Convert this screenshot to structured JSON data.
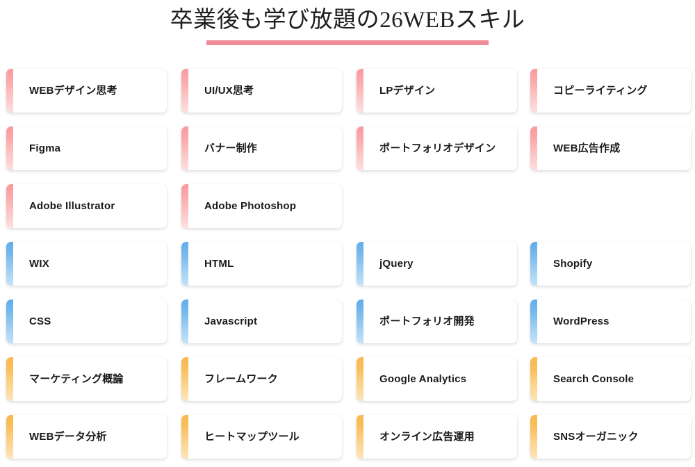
{
  "heading": {
    "title": "卒業後も学び放題の26WEBスキル",
    "rule_color": "#ef8c99"
  },
  "palette": {
    "pink_top": "#f89a9d",
    "pink_bottom": "#fde0df",
    "blue_top": "#62acea",
    "blue_bottom": "#c4e2f7",
    "orange_top": "#f8b84e",
    "orange_bottom": "#fde4b8",
    "card_background": "#ffffff",
    "text": "#1a1a1a",
    "page_background": "#ffffff"
  },
  "grid": {
    "columns": 4,
    "rows": 7,
    "total_cards": 26
  },
  "cards": [
    {
      "label": "WEBデザイン思考",
      "accent": "pink",
      "row": 1,
      "col": 1
    },
    {
      "label": "UI/UX思考",
      "accent": "pink",
      "row": 1,
      "col": 2
    },
    {
      "label": "LPデザイン",
      "accent": "pink",
      "row": 1,
      "col": 3
    },
    {
      "label": "コピーライティング",
      "accent": "pink",
      "row": 1,
      "col": 4
    },
    {
      "label": "Figma",
      "accent": "pink",
      "row": 2,
      "col": 1
    },
    {
      "label": "バナー制作",
      "accent": "pink",
      "row": 2,
      "col": 2
    },
    {
      "label": "ポートフォリオデザイン",
      "accent": "pink",
      "row": 2,
      "col": 3
    },
    {
      "label": "WEB広告作成",
      "accent": "pink",
      "row": 2,
      "col": 4
    },
    {
      "label": "Adobe Illustrator",
      "accent": "pink",
      "row": 3,
      "col": 1
    },
    {
      "label": "Adobe Photoshop",
      "accent": "pink",
      "row": 3,
      "col": 2
    },
    {
      "label": "WIX",
      "accent": "blue",
      "row": 4,
      "col": 1
    },
    {
      "label": "HTML",
      "accent": "blue",
      "row": 4,
      "col": 2
    },
    {
      "label": "jQuery",
      "accent": "blue",
      "row": 4,
      "col": 3
    },
    {
      "label": "Shopify",
      "accent": "blue",
      "row": 4,
      "col": 4
    },
    {
      "label": "CSS",
      "accent": "blue",
      "row": 5,
      "col": 1
    },
    {
      "label": "Javascript",
      "accent": "blue",
      "row": 5,
      "col": 2
    },
    {
      "label": "ポートフォリオ開発",
      "accent": "blue",
      "row": 5,
      "col": 3
    },
    {
      "label": "WordPress",
      "accent": "blue",
      "row": 5,
      "col": 4
    },
    {
      "label": "マーケティング概論",
      "accent": "orange",
      "row": 6,
      "col": 1
    },
    {
      "label": "フレームワーク",
      "accent": "orange",
      "row": 6,
      "col": 2
    },
    {
      "label": "Google Analytics",
      "accent": "orange",
      "row": 6,
      "col": 3
    },
    {
      "label": "Search Console",
      "accent": "orange",
      "row": 6,
      "col": 4
    },
    {
      "label": "WEBデータ分析",
      "accent": "orange",
      "row": 7,
      "col": 1
    },
    {
      "label": "ヒートマップツール",
      "accent": "orange",
      "row": 7,
      "col": 2
    },
    {
      "label": "オンライン広告運用",
      "accent": "orange",
      "row": 7,
      "col": 3
    },
    {
      "label": "SNSオーガニック",
      "accent": "orange",
      "row": 7,
      "col": 4
    }
  ]
}
